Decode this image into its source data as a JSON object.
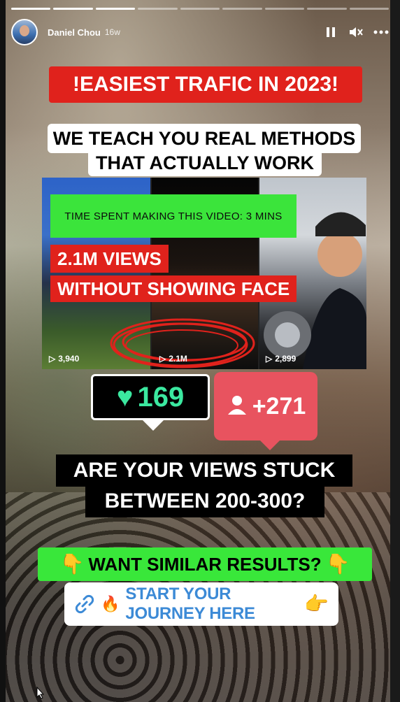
{
  "story": {
    "segments_total": 9,
    "segments_done": 3,
    "username": "Daniel Chou",
    "time_ago": "16w",
    "icons": [
      "pause-icon",
      "mute-icon",
      "more-icon"
    ]
  },
  "overlay": {
    "headline": "!EASIEST TRAFIC IN 2023!",
    "teach_line1": "WE TEACH YOU REAL METHODS",
    "teach_line2": "THAT ACTUALLY WORK",
    "collage": {
      "time_spent": "TIME SPENT MAKING THIS VIDEO: 3 MINS",
      "views_label": "2.1M VIEWS",
      "face_label": "WITHOUT SHOWING FACE",
      "counts": [
        "3,940",
        "2.1M",
        "2,899"
      ]
    },
    "likes": "169",
    "followers": "+271",
    "question_line1": "ARE YOUR VIEWS STUCK",
    "question_line2": "BETWEEN 200-300?",
    "cta": "WANT SIMILAR RESULTS?",
    "link_text": "START YOUR JOURNEY HERE"
  },
  "colors": {
    "headline_red": "#e0221c",
    "cta_green": "#39e73a",
    "like_green": "#3be8a0",
    "follow_pink": "#e8535f",
    "link_blue": "#3c8ad6"
  }
}
